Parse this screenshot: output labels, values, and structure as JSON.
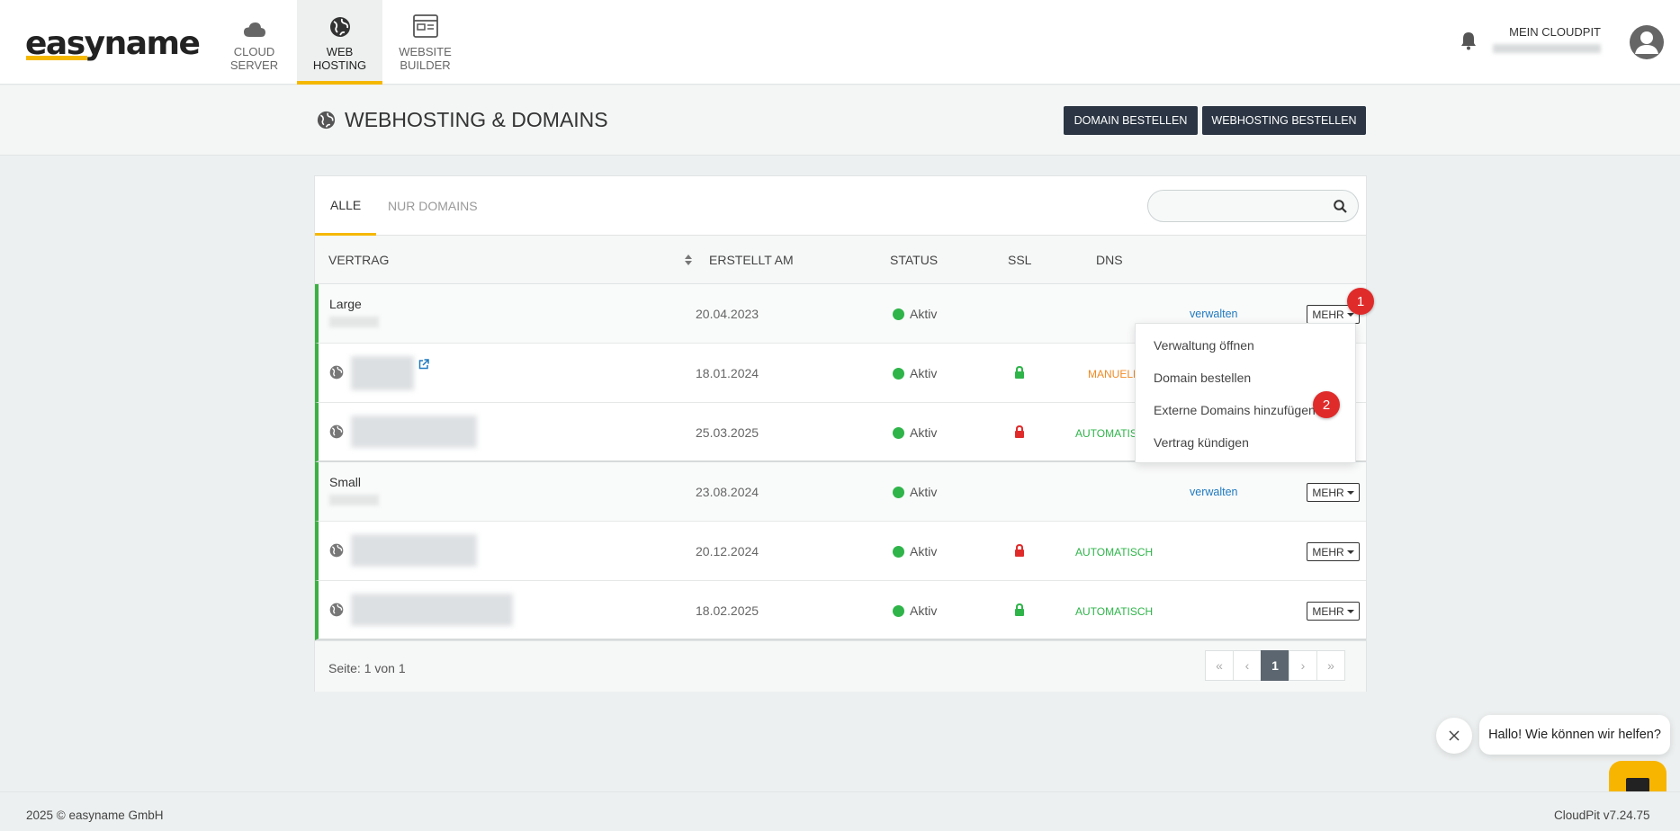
{
  "brand": {
    "logo": "easyname"
  },
  "nav": [
    {
      "label1": "CLOUD",
      "label2": "SERVER",
      "icon": "cloud-icon"
    },
    {
      "label1": "WEB",
      "label2": "HOSTING",
      "icon": "globe-icon",
      "active": true
    },
    {
      "label1": "WEBSITE",
      "label2": "BUILDER",
      "icon": "website-builder-icon"
    }
  ],
  "account": {
    "label": "MEIN CLOUDPIT"
  },
  "page": {
    "title": "WEBHOSTING & DOMAINS",
    "btn_domain": "DOMAIN BESTELLEN",
    "btn_webhosting": "WEBHOSTING BESTELLEN"
  },
  "tabs": {
    "all": "ALLE",
    "domains": "NUR DOMAINS"
  },
  "search": {
    "placeholder": ""
  },
  "table": {
    "headers": {
      "contract": "VERTRAG",
      "created": "ERSTELLT AM",
      "status": "STATUS",
      "ssl": "SSL",
      "dns": "DNS"
    },
    "rows": [
      {
        "name": "Large",
        "date": "20.04.2023",
        "status": "Aktiv",
        "action": "verwalten",
        "more": "MEHR"
      },
      {
        "date": "18.01.2024",
        "status": "Aktiv",
        "ssl_color": "#2fb44a",
        "dns": "MANUELL"
      },
      {
        "date": "25.03.2025",
        "status": "Aktiv",
        "ssl_color": "#e02b2b",
        "dns": "AUTOMATISCH"
      },
      {
        "name": "Small",
        "date": "23.08.2024",
        "status": "Aktiv",
        "action": "verwalten",
        "more": "MEHR"
      },
      {
        "date": "20.12.2024",
        "status": "Aktiv",
        "ssl_color": "#e02b2b",
        "dns": "AUTOMATISCH",
        "more": "MEHR"
      },
      {
        "date": "18.02.2025",
        "status": "Aktiv",
        "ssl_color": "#2fb44a",
        "dns": "AUTOMATISCH",
        "more": "MEHR"
      }
    ],
    "page_info": "Seite: 1 von 1",
    "pager": {
      "first": "«",
      "prev": "‹",
      "current": "1",
      "next": "›",
      "last": "»"
    }
  },
  "dropdown": {
    "items": [
      "Verwaltung öffnen",
      "Domain bestellen",
      "Externe Domains hinzufügen",
      "Vertrag kündigen"
    ]
  },
  "markers": [
    "1",
    "2"
  ],
  "chat": {
    "greeting": "Hallo! Wie können wir helfen?"
  },
  "footer": {
    "copyright": "2025 © easyname GmbH",
    "version": "CloudPit v7.24.75"
  },
  "colors": {
    "accent": "#f5b800",
    "dark_button": "#2b3543",
    "active": "#2fb44a",
    "link": "#1f7ac0",
    "manual": "#f08a24",
    "badge": "#e02b2b"
  }
}
